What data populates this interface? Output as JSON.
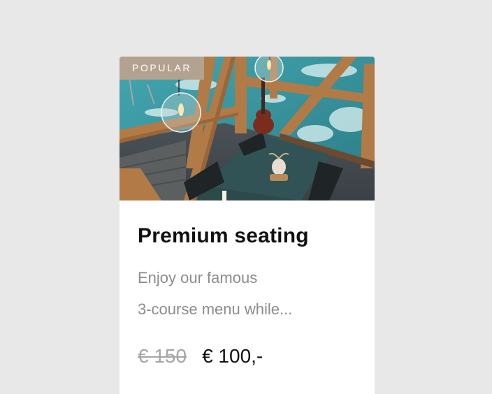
{
  "card": {
    "badge": "POPULAR",
    "image_alt": "Dining table with lamps by a window overlooking the water",
    "title": "Premium seating",
    "description_line1": "Enjoy our famous",
    "description_line2": "3-course menu while...",
    "old_price": "€ 150",
    "new_price": "€ 100,-"
  },
  "colors": {
    "page_bg": "#e8e8e8",
    "card_bg": "#ffffff",
    "badge_bg": "#b3a28f",
    "title": "#111111",
    "description": "#8c8c8c",
    "old_price": "#a5a5a5"
  }
}
